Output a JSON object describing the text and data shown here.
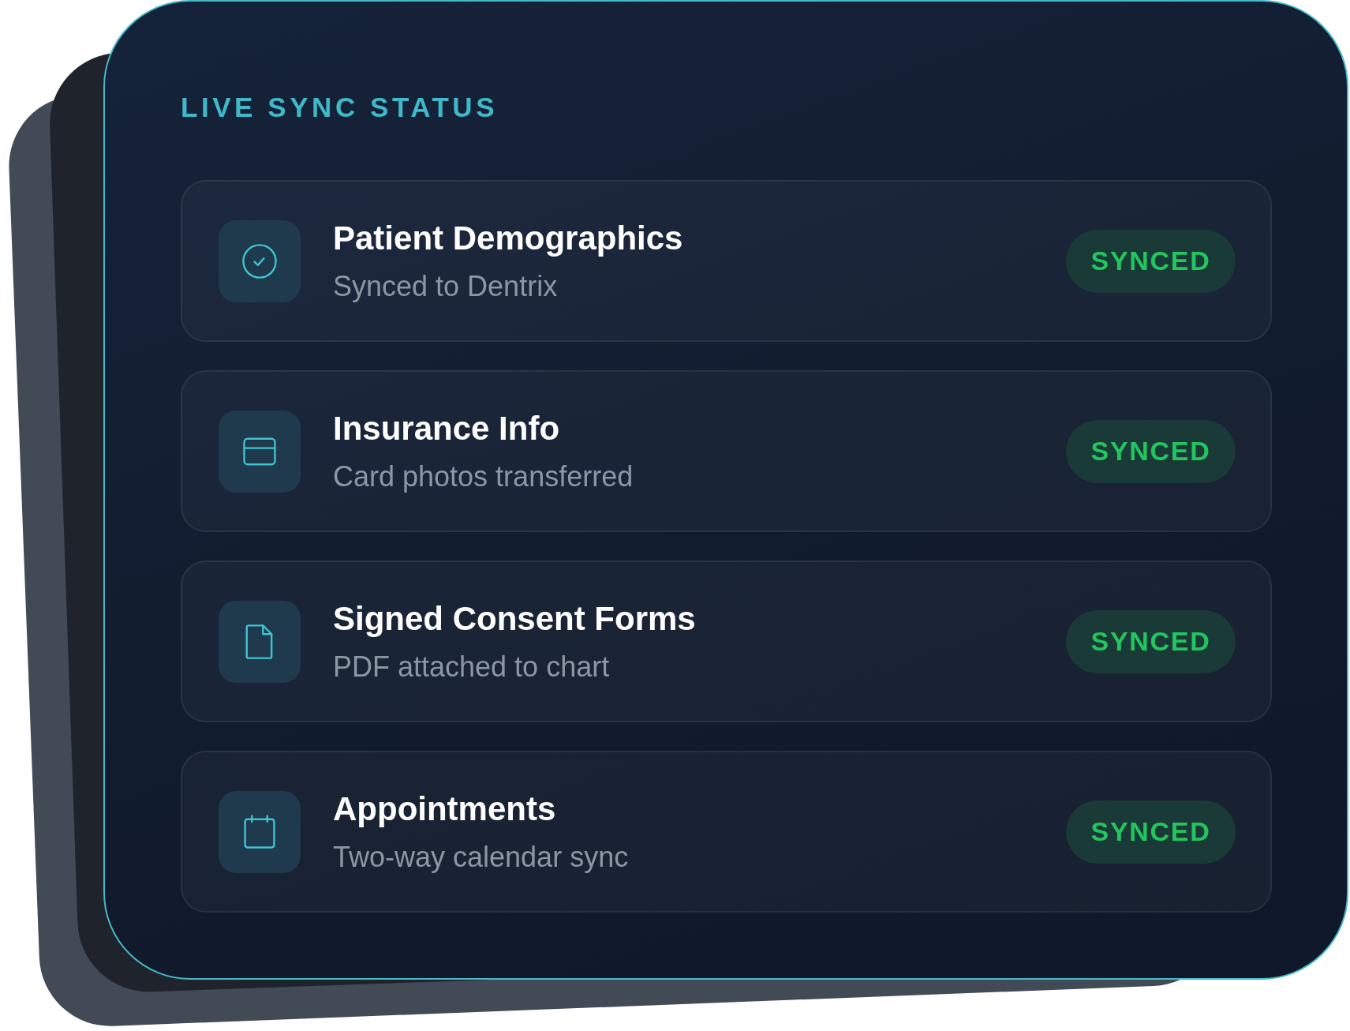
{
  "title": "LIVE SYNC STATUS",
  "items": [
    {
      "kind": "check",
      "title": "Patient Demographics",
      "subtitle": "Synced to Dentrix",
      "status": "SYNCED"
    },
    {
      "kind": "card",
      "title": "Insurance Info",
      "subtitle": "Card photos transferred",
      "status": "SYNCED"
    },
    {
      "kind": "document",
      "title": "Signed Consent Forms",
      "subtitle": "PDF attached to chart",
      "status": "SYNCED"
    },
    {
      "kind": "calendar",
      "title": "Appointments",
      "subtitle": "Two-way calendar sync",
      "status": "SYNCED"
    }
  ]
}
